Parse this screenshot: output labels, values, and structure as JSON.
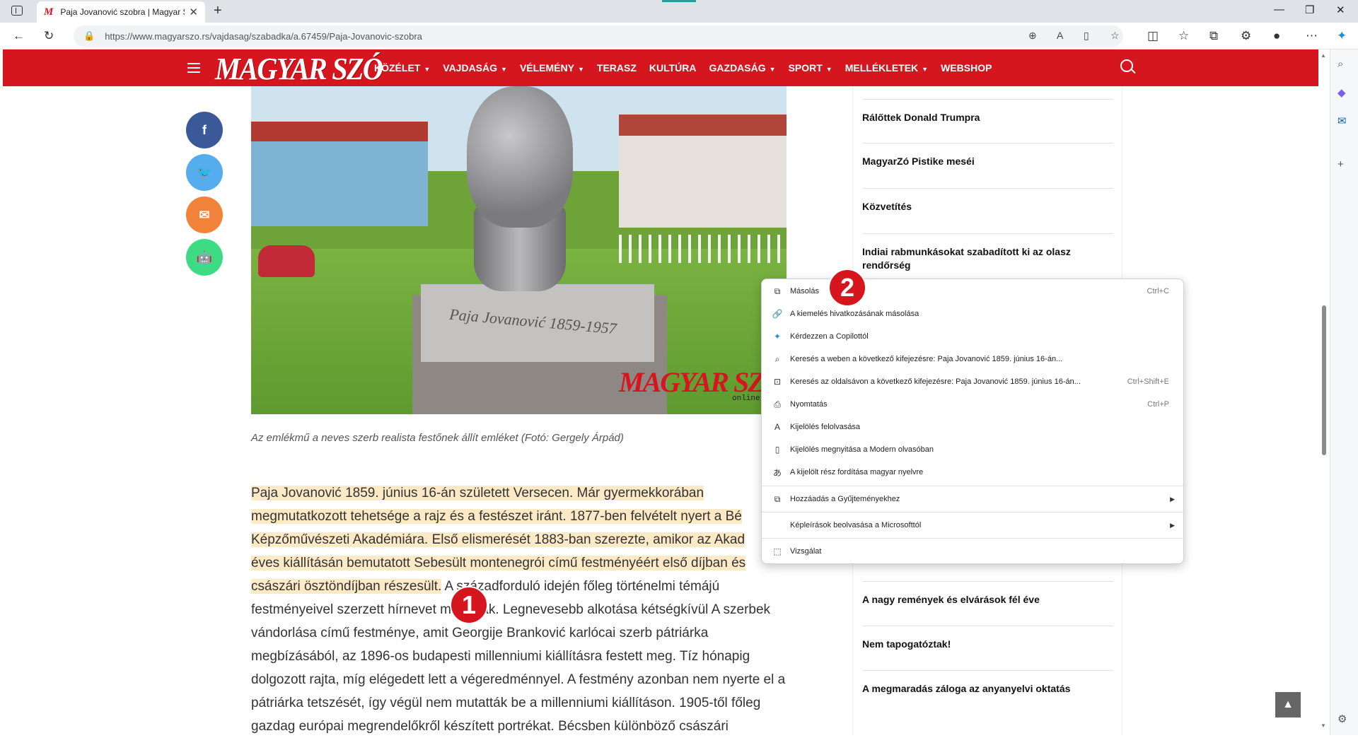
{
  "browser": {
    "tab_title": "Paja Jovanović szobra | Magyar Sz",
    "favicon": "M",
    "url": "https://www.magyarszo.rs/vajdasag/szabadka/a.67459/Paja-Jovanovic-szobra"
  },
  "site": {
    "logo": "MAGYAR SZÓ",
    "nav": [
      {
        "label": "KÖZÉLET",
        "dropdown": true
      },
      {
        "label": "VAJDASÁG",
        "dropdown": true
      },
      {
        "label": "VÉLEMÉNY",
        "dropdown": true
      },
      {
        "label": "TERASZ",
        "dropdown": false
      },
      {
        "label": "KULTÚRA",
        "dropdown": false
      },
      {
        "label": "GAZDASÁG",
        "dropdown": true
      },
      {
        "label": "SPORT",
        "dropdown": true
      },
      {
        "label": "MELLÉKLETEK",
        "dropdown": true
      },
      {
        "label": "WEBSHOP",
        "dropdown": false
      }
    ]
  },
  "social": [
    {
      "name": "facebook",
      "glyph": "f",
      "color": "#3b5998"
    },
    {
      "name": "twitter",
      "glyph": "🐦",
      "color": "#55acee"
    },
    {
      "name": "email",
      "glyph": "✉",
      "color": "#f0823a"
    },
    {
      "name": "android",
      "glyph": "🤖",
      "color": "#3ddc84"
    }
  ],
  "photo": {
    "plaque_text": "Paja Jovanović 1859-1957",
    "watermark": "MAGYAR SZÓ",
    "watermark_sub": "online"
  },
  "article": {
    "caption": "Az emlékmű a neves szerb realista festőnek állít emléket (Fotó: Gergely Árpád)",
    "lines": [
      {
        "hl": "Paja Jovanović 1859. június 16-án született Versecen. Már gyermekkorában",
        "rest": ""
      },
      {
        "hl": "megmutatkozott tehetsége a rajz és a festészet iránt. 1877-ben felvételt nyert a Bé",
        "rest": ""
      },
      {
        "hl": "Képzőművészeti Akadémiára. Első elismerését 1883-ban szerezte, amikor az Akad",
        "rest": ""
      },
      {
        "hl": "éves kiállításán bemutatott Sebesült montenegrói című festményéért első díjban és",
        "rest": ""
      },
      {
        "hl": "császári ösztöndíjban részesült.",
        "rest": " A századforduló idején főleg történelmi témájú"
      },
      {
        "hl": "",
        "rest": "festményeivel szerzett hírnevet magának. Legnevesebb alkotása kétségkívül A szerbek"
      },
      {
        "hl": "",
        "rest": "vándorlása című festménye, amit Georgije Branković karlócai szerb pátriárka"
      },
      {
        "hl": "",
        "rest": "megbízásából, az 1896-os budapesti millenniumi kiállításra festett meg. Tíz hónapig"
      },
      {
        "hl": "",
        "rest": "dolgozott rajta, míg elégedett lett a végeredménnyel. A festmény azonban nem nyerte el a"
      },
      {
        "hl": "",
        "rest": "pátriárka tetszését, így végül nem mutatták be a millenniumi kiállításon. 1905-től főleg"
      },
      {
        "hl": "",
        "rest": "gazdag európai megrendelőkről készített portrékat. Bécsben különböző császári"
      }
    ]
  },
  "sidebar": {
    "items": [
      "Rálőttek Donald Trumpra",
      "MagyarZó Pistike meséi",
      "Közvetítés",
      "Indiai rabmunkásokat szabadított ki az olasz rendőrség",
      "A nagy remények és elvárások fél éve",
      "Nem tapogatóztak!",
      "A megmaradás záloga az anyanyelvi oktatás"
    ]
  },
  "context_menu": {
    "items": [
      {
        "label": "Másolás",
        "icon": "copy-icon",
        "glyph": "⧉",
        "shortcut": "Ctrl+C",
        "submenu": false
      },
      {
        "label": "A kiemelés hivatkozásának másolása",
        "icon": "link-highlight-icon",
        "glyph": "🔗",
        "shortcut": "",
        "submenu": false
      },
      {
        "label": "Kérdezzen a Copilottól",
        "icon": "copilot-icon",
        "glyph": "✦",
        "shortcut": "",
        "submenu": false
      },
      {
        "label": "Keresés a weben a következő kifejezésre: Paja Jovanović 1859. június 16-án...",
        "icon": "search-icon",
        "glyph": "⌕",
        "shortcut": "",
        "submenu": false
      },
      {
        "label": "Keresés az oldalsávon a következő kifejezésre: Paja Jovanović 1859. június 16-án...",
        "icon": "sidebar-search-icon",
        "glyph": "⊡",
        "shortcut": "Ctrl+Shift+E",
        "submenu": false
      },
      {
        "label": "Nyomtatás",
        "icon": "print-icon",
        "glyph": "⎙",
        "shortcut": "Ctrl+P",
        "submenu": false
      },
      {
        "label": "Kijelölés felolvasása",
        "icon": "read-aloud-icon",
        "glyph": "A",
        "shortcut": "",
        "submenu": false
      },
      {
        "label": "Kijelölés megnyitása a Modern olvasóban",
        "icon": "immersive-reader-icon",
        "glyph": "▯",
        "shortcut": "",
        "submenu": false
      },
      {
        "label": "A kijelölt rész fordítása magyar nyelvre",
        "icon": "translate-icon",
        "glyph": "あ",
        "shortcut": "",
        "submenu": false
      },
      {
        "label": "Hozzáadás a Gyűjteményekhez",
        "icon": "collections-icon",
        "glyph": "⧉",
        "shortcut": "",
        "submenu": true
      },
      {
        "label": "Képleírások beolvasása a Microsofttól",
        "icon": "",
        "glyph": "",
        "shortcut": "",
        "submenu": true
      },
      {
        "label": "Vizsgálat",
        "icon": "inspect-icon",
        "glyph": "⬚",
        "shortcut": "",
        "submenu": false
      }
    ]
  },
  "badges": [
    "1",
    "2"
  ],
  "back_to_top": "▲"
}
